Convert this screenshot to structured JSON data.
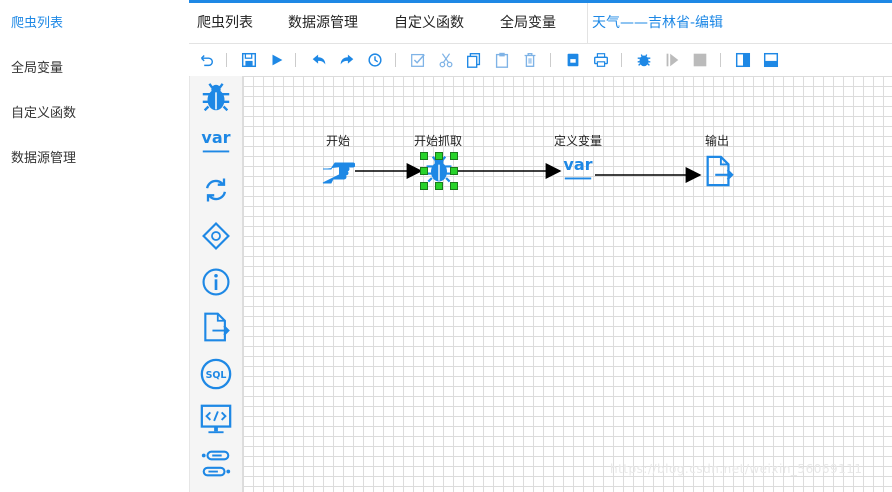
{
  "sidebar": {
    "items": [
      {
        "label": "爬虫列表",
        "active": true
      },
      {
        "label": "全局变量",
        "active": false
      },
      {
        "label": "自定义函数",
        "active": false
      },
      {
        "label": "数据源管理",
        "active": false
      }
    ]
  },
  "tabs": [
    {
      "label": "爬虫列表"
    },
    {
      "label": "数据源管理"
    },
    {
      "label": "自定义函数"
    },
    {
      "label": "全局变量"
    },
    {
      "label": "天气——吉林省-编辑",
      "active": true
    }
  ],
  "toolbar": {
    "icons": [
      "undo-icon",
      "save-icon",
      "run-icon",
      "redo-left-icon",
      "redo-right-icon",
      "history-icon",
      "check-icon",
      "cut-icon",
      "copy-icon",
      "paste-icon",
      "delete-icon",
      "export-icon",
      "print-icon",
      "debug-icon",
      "step-icon",
      "stop-icon",
      "panel-left-icon",
      "panel-bottom-icon"
    ]
  },
  "palette": {
    "icons": [
      "spider-icon",
      "variable-icon",
      "loop-icon",
      "diamond-icon",
      "info-icon",
      "output-icon",
      "sql-icon",
      "code-icon",
      "process-icon"
    ],
    "var_text": "var"
  },
  "flow": {
    "nodes": [
      {
        "id": "start",
        "label": "开始",
        "icon": "hand-pointer-icon"
      },
      {
        "id": "crawl",
        "label": "开始抓取",
        "icon": "spider-icon",
        "selected": true
      },
      {
        "id": "define",
        "label": "定义变量",
        "icon": "variable-icon",
        "text": "var"
      },
      {
        "id": "output",
        "label": "输出",
        "icon": "output-icon"
      }
    ]
  },
  "colors": {
    "accent": "#1e88e5",
    "handle": "#28d32a"
  },
  "watermark": "https://blog.csdn.net/weixin_56069111"
}
